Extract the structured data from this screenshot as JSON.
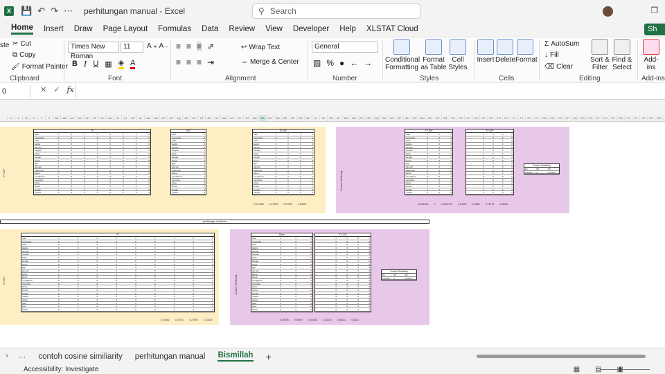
{
  "window": {
    "doc_title": "perhitungan manual",
    "app": "Excel",
    "separator": " - ",
    "search_placeholder": "Search"
  },
  "tabs": [
    "Home",
    "Insert",
    "Draw",
    "Page Layout",
    "Formulas",
    "Data",
    "Review",
    "View",
    "Developer",
    "Help",
    "XLSTAT Cloud"
  ],
  "share_label": "Sh",
  "ribbon": {
    "clipboard": {
      "label": "Clipboard",
      "cut": "Cut",
      "copy": "Copy",
      "format_painter": "Format Painter",
      "paste": "ste"
    },
    "font": {
      "label": "Font",
      "name": "Times New Roman",
      "size": "11"
    },
    "alignment": {
      "label": "Alignment",
      "wrap": "Wrap Text",
      "merge": "Merge & Center"
    },
    "number": {
      "label": "Number",
      "format": "General"
    },
    "styles": {
      "label": "Styles",
      "cond": "Conditional Formatting",
      "table": "Format as Table",
      "cell": "Cell Styles"
    },
    "cells": {
      "label": "Cells",
      "insert": "Insert",
      "delete": "Delete",
      "format": "Format"
    },
    "editing": {
      "label": "Editing",
      "autosum": "AutoSum",
      "fill": "Fill",
      "clear": "Clear",
      "sort": "Sort & Filter",
      "find": "Find & Select"
    },
    "addins": {
      "label": "Add-ins",
      "btn": "Add-ins"
    }
  },
  "formula_bar": {
    "name_box": "0",
    "fx": "fx"
  },
  "columns": [
    "",
    "U",
    "V",
    "W",
    "X",
    "Y",
    "Z",
    "AA",
    "AB",
    "AC",
    "AD",
    "AE",
    "AF",
    "AG",
    "AH",
    "AI",
    "AJ",
    "AK",
    "AL",
    "AM",
    "AN",
    "AO",
    "AP",
    "AQ",
    "AR",
    "AS",
    "AT",
    "AU",
    "AV",
    "AW",
    "AX",
    "AY",
    "AZ",
    "BA",
    "BB",
    "BC",
    "BD",
    "BE",
    "BF",
    "BG",
    "BH",
    "BI",
    "BJ",
    "BK",
    "BL",
    "BM",
    "BN",
    "BO",
    "BP",
    "BQ",
    "BR",
    "BS",
    "BT",
    "BU",
    "BV",
    "BW",
    "BX",
    "BY",
    "BZ",
    "CA",
    "CB",
    "CC",
    "CD",
    "CE",
    "CF",
    "CG",
    "CH",
    "CI",
    "CJ",
    "CK",
    "CL",
    "CM",
    "CN",
    "CO",
    "CP",
    "CQ",
    "CR",
    "CS",
    "CT",
    "CU",
    "CV",
    "CW",
    "CX",
    "CY",
    "CZ",
    "DA",
    "DB"
  ],
  "sheet": {
    "tf_idf_label": "TF-IDF",
    "cosine_label": "Cosine Similarity",
    "tf_header": "TF",
    "idf_header": "IDF",
    "tfidf_header": "TF-IDF",
    "cos_sim_box": "Cosine Similarity",
    "stem_header": "Stem",
    "row_terms": [
      "rasa",
      "menyedot",
      "cakit",
      "lagida",
      "demam",
      "mulyab",
      "kalau",
      "sangat",
      "buruk",
      "gigi",
      "gampel",
      "makintegi",
      "kabut",
      "mungkinna",
      "menyibot",
      "lekas",
      "timbul",
      "kepala",
      "mayba",
      "udara",
      "sakit",
      "gusi",
      "kakak"
    ],
    "lower_terms": [
      "rasa",
      "menyedot",
      "sakit",
      "lagida",
      "demam",
      "mulyab",
      "kalau",
      "sangat",
      "buruk",
      "gigi",
      "gampel",
      "kabut",
      "tubuh",
      "mungkinna",
      "menyibot",
      "lekas",
      "timbul",
      "kepala",
      "mayba",
      "udara",
      "sakit",
      "gusi",
      "kakak",
      "badan",
      "hidung",
      "pusing"
    ],
    "totals_top": [
      "0,079488",
      "0,27959",
      "0,27959",
      "0,23637"
    ],
    "totals_top_right": [
      "0,062401",
      "0",
      "0,0202472",
      "0,04601",
      "0,0585",
      "0,14778",
      "0,08541"
    ],
    "totals_bottom": [
      "0,04462",
      "0,27673",
      "0,27693",
      "0,23424"
    ],
    "totals_bottom_right": [
      "0,00035",
      "0,00697",
      "0,04462",
      "0,02423",
      "0,06022",
      "0,0221"
    ],
    "perhitungan_label": "perhitungan kuesioner",
    "cosine_results_top": [
      "0,40007",
      "0",
      "0,06453"
    ],
    "cosine_results_bottom": [
      "0,00412",
      "0",
      "0,00412"
    ],
    "cos_headers": [
      "D1",
      "D2",
      "D3"
    ]
  },
  "sheet_tabs": [
    "contoh cosine similiarity",
    "perhitungan manual",
    "Bismillah"
  ],
  "active_sheet": "Bismillah",
  "status": {
    "accessibility": "Accessibility: Investigate"
  },
  "colors": {
    "accent": "#1f7244",
    "yellow": "#fdefc3",
    "purple": "#e8c8e8"
  }
}
